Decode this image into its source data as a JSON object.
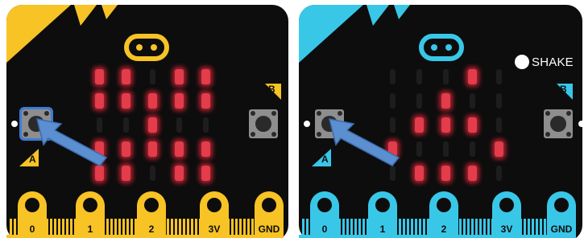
{
  "colors": {
    "left_accent": "#f7c325",
    "right_accent": "#39c7e8",
    "led_on": "#e33c4a",
    "highlight": "#3d7ad6"
  },
  "left_board": {
    "button_a_label": "A",
    "button_b_label": "B",
    "pins": [
      "0",
      "1",
      "2",
      "3V",
      "GND"
    ],
    "led_grid": [
      [
        1,
        1,
        0,
        1,
        1
      ],
      [
        1,
        1,
        1,
        1,
        1
      ],
      [
        0,
        0,
        1,
        0,
        0
      ],
      [
        1,
        1,
        1,
        1,
        1
      ],
      [
        1,
        1,
        0,
        1,
        1
      ]
    ],
    "highlighted_button": "A",
    "icons": [
      "microbit-logo-icon",
      "arrow-icon"
    ]
  },
  "right_board": {
    "gesture_label": "SHAKE",
    "button_a_label": "A",
    "button_b_label": "B",
    "pins": [
      "0",
      "1",
      "2",
      "3V",
      "GND"
    ],
    "led_grid": [
      [
        0,
        0,
        0,
        1,
        0
      ],
      [
        0,
        0,
        1,
        0,
        0
      ],
      [
        0,
        1,
        1,
        1,
        0
      ],
      [
        1,
        0,
        0,
        0,
        1
      ],
      [
        0,
        1,
        1,
        1,
        0
      ]
    ],
    "icons": [
      "microbit-logo-icon",
      "arrow-icon",
      "shake-dot-icon"
    ]
  }
}
